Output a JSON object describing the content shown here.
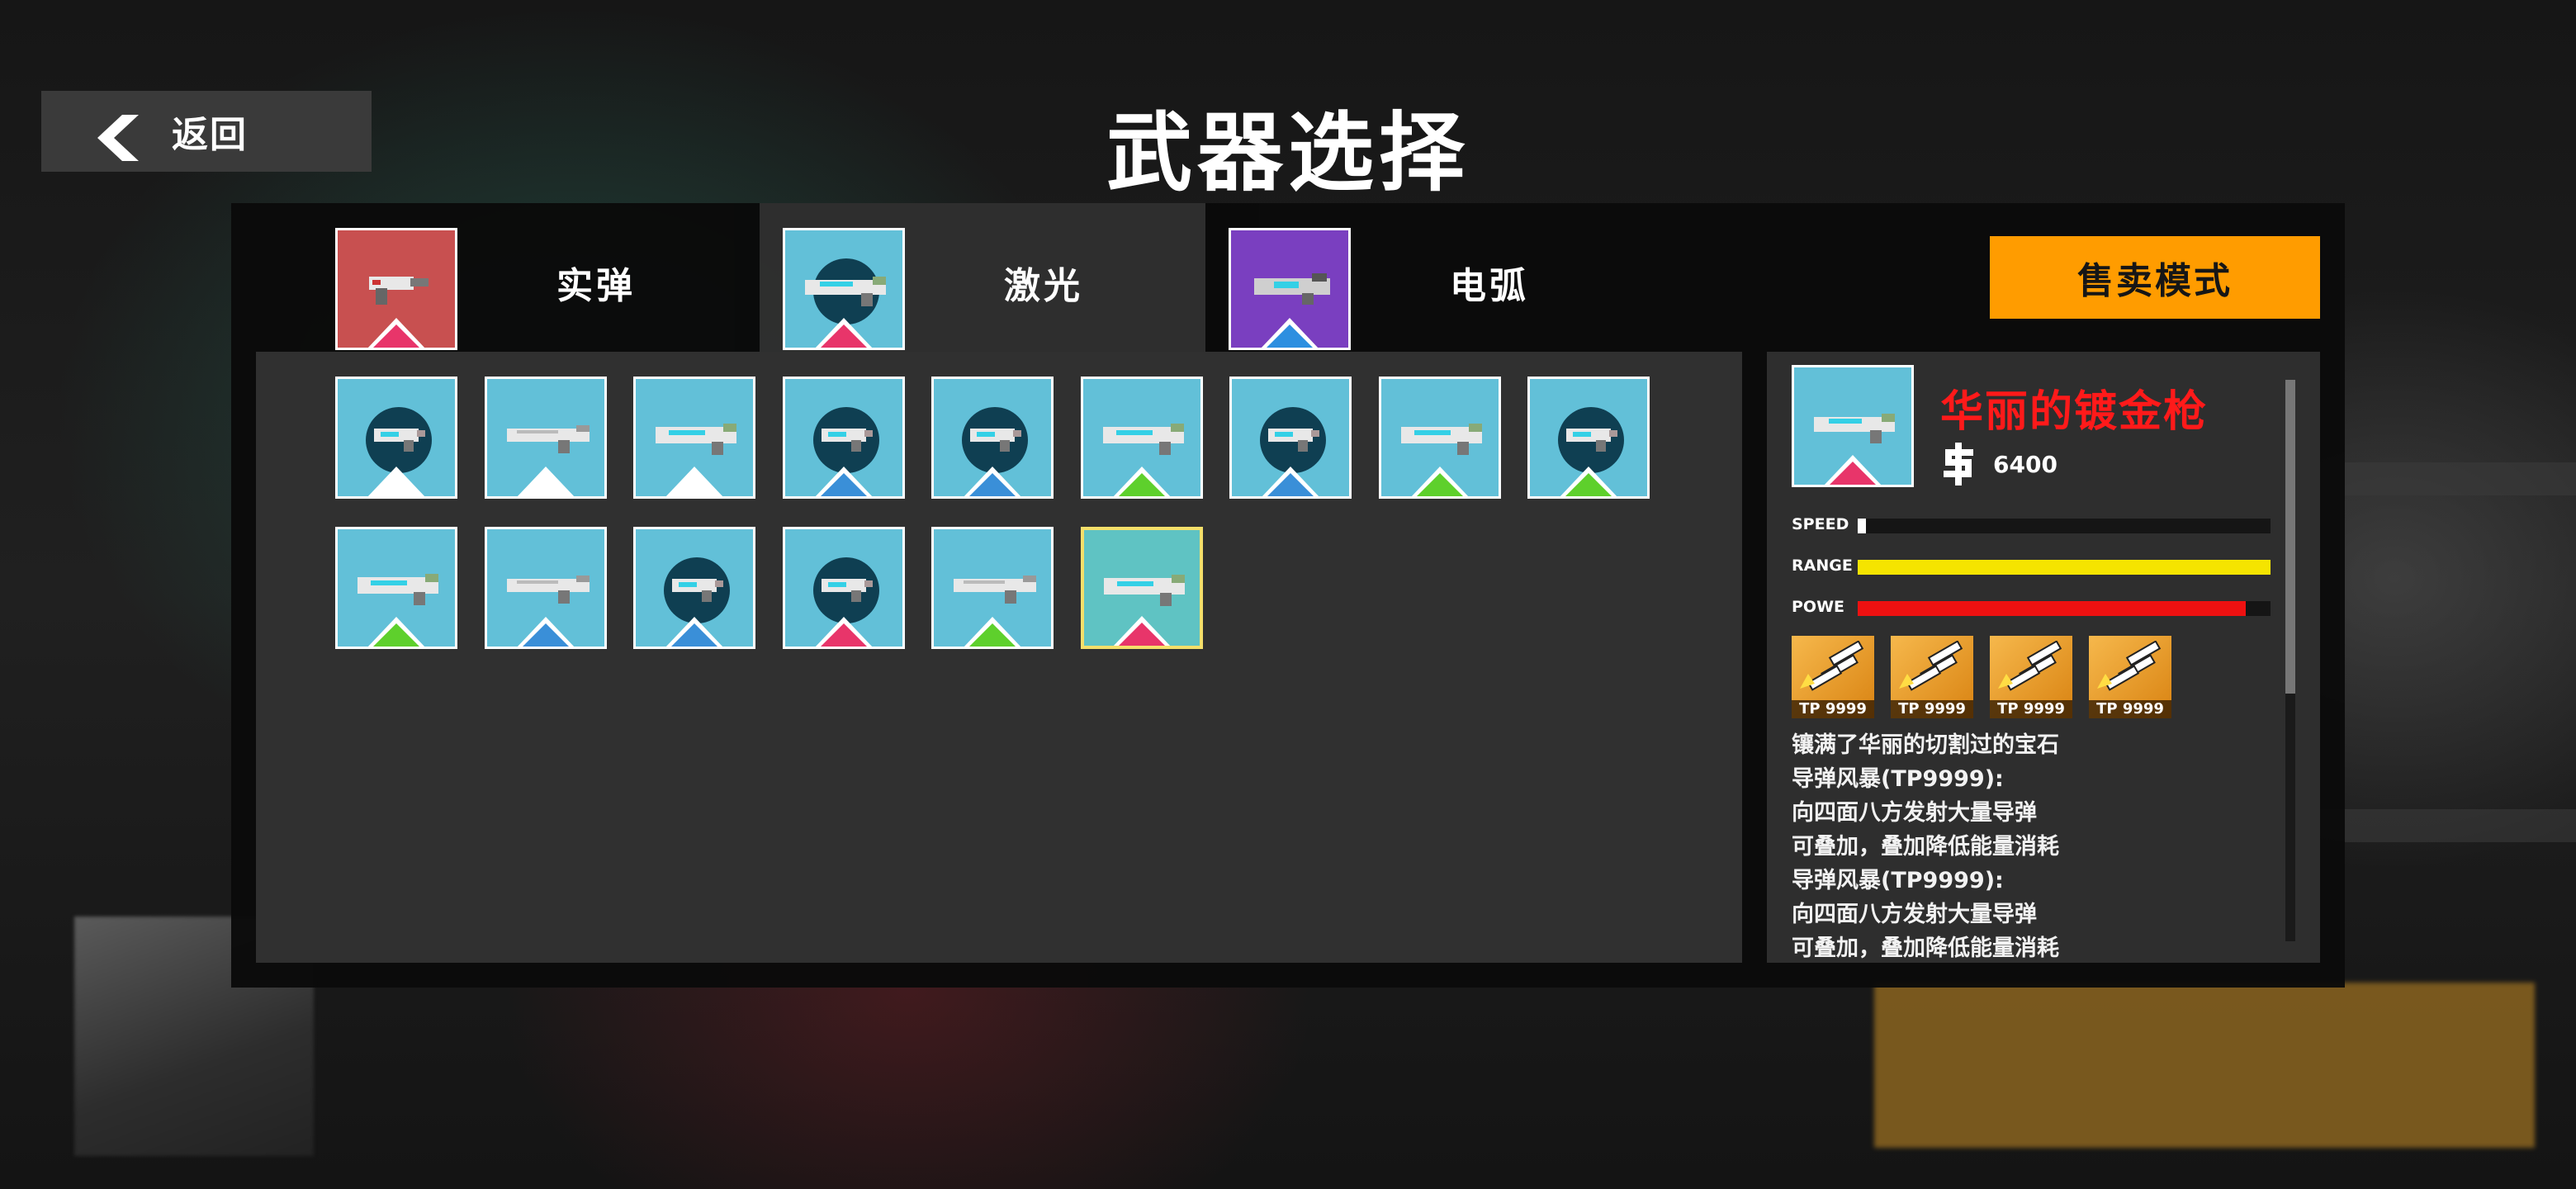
{
  "back": {
    "label": "返回"
  },
  "page_title": "武器选择",
  "tabs": [
    {
      "label": "实弹",
      "active": false,
      "icon_bg": "#c85050",
      "marker": "#e8356a"
    },
    {
      "label": "激光",
      "active": true,
      "icon_bg": "#62c0d8",
      "marker": "#e8356a"
    },
    {
      "label": "电弧",
      "active": false,
      "icon_bg": "#7a3fc0",
      "marker": "#2d8fe0"
    }
  ],
  "sell_mode": "售卖模式",
  "grid": {
    "rows": [
      [
        {
          "gun": "pistol",
          "marker": "#ffffff"
        },
        {
          "gun": "rifle",
          "marker": "#ffffff"
        },
        {
          "gun": "laser",
          "marker": "#ffffff"
        },
        {
          "gun": "pistol",
          "marker": "#3a8fd8"
        },
        {
          "gun": "pistol",
          "marker": "#3a8fd8"
        },
        {
          "gun": "laser",
          "marker": "#5ed02c"
        },
        {
          "gun": "pistol",
          "marker": "#3a8fd8"
        },
        {
          "gun": "laser",
          "marker": "#5ed02c"
        },
        {
          "gun": "pistol",
          "marker": "#5ed02c"
        }
      ],
      [
        {
          "gun": "laser",
          "marker": "#5ed02c"
        },
        {
          "gun": "rifle",
          "marker": "#3a8fd8"
        },
        {
          "gun": "pistol",
          "marker": "#3a8fd8"
        },
        {
          "gun": "pistol",
          "marker": "#e8356a"
        },
        {
          "gun": "rifle",
          "marker": "#5ed02c"
        },
        {
          "gun": "laser",
          "marker": "#e8356a",
          "selected": true
        }
      ]
    ]
  },
  "detail": {
    "name": "华丽的镀金枪",
    "price": "6400",
    "stats": [
      {
        "label": "SPEED",
        "value": 0.02,
        "color": "#ffffff"
      },
      {
        "label": "RANGE",
        "value": 1.0,
        "color": "#f5e400"
      },
      {
        "label": "POWE",
        "value": 0.94,
        "color": "#ee1111"
      }
    ],
    "skills": [
      "TP 9999",
      "TP 9999",
      "TP 9999",
      "TP 9999"
    ],
    "description": [
      "镶满了华丽的切割过的宝石",
      "导弹风暴(TP9999):",
      "向四面八方发射大量导弹",
      "可叠加，叠加降低能量消耗",
      "导弹风暴(TP9999):",
      "向四面八方发射大量导弹",
      "可叠加，叠加降低能量消耗"
    ]
  }
}
